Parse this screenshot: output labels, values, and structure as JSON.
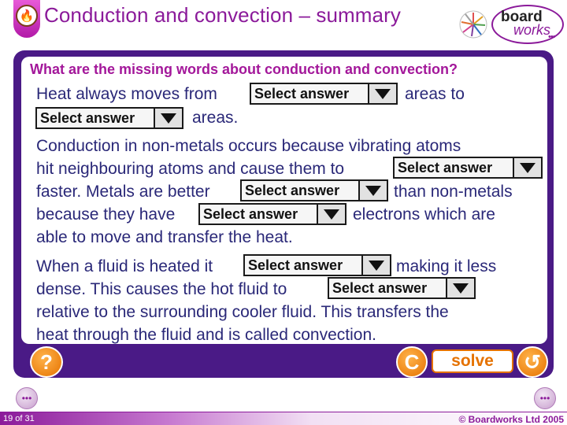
{
  "header": {
    "title": "Conduction and convection – summary",
    "header_icon": "flame-icon",
    "logo_board": "board",
    "logo_works": "works",
    "logo_dots": "•••"
  },
  "question": "What are the missing words about conduction and convection?",
  "select_label": "Select answer",
  "paragraph1": {
    "l1a": "Heat always moves from",
    "l1b": "areas to",
    "l2b": "areas."
  },
  "paragraph2": {
    "l1": "Conduction in non-metals occurs because vibrating atoms",
    "l2a": "hit neighbouring atoms and cause them to",
    "l3a": "faster. Metals are better",
    "l3b": "than non-metals",
    "l4a": "because they have",
    "l4b": "electrons which are",
    "l5": "able to move and transfer the heat."
  },
  "paragraph3": {
    "l1a": "When a fluid is heated it",
    "l1b": "making it less",
    "l2a": "dense. This causes the hot fluid to",
    "l3": "relative to the surrounding cooler fluid. This transfers the",
    "l4": "heat through the fluid and is called convection."
  },
  "controls": {
    "help": "?",
    "clear": "C",
    "solve": "solve",
    "reset": "↺"
  },
  "footer": {
    "page": "19 of 31",
    "copyright": "© Boardworks Ltd 2005",
    "prev_label": "•••",
    "next_label": "•••"
  },
  "colors": {
    "panel": "#4a1a86",
    "title": "#8b1a9a",
    "question": "#a3179a",
    "body_text": "#2a2878",
    "button": "#e57200"
  }
}
